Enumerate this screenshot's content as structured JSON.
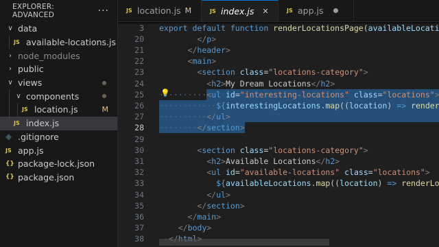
{
  "explorer": {
    "title": "EXPLORER: ADVANCED",
    "more": "···",
    "items": [
      {
        "label": "data",
        "chevron": "∨",
        "indent": 0,
        "type": "folder"
      },
      {
        "label": "available-locations.js",
        "indent": 1,
        "type": "js",
        "icon": "JS"
      },
      {
        "label": "node_modules",
        "chevron": "›",
        "indent": 0,
        "type": "folder",
        "dim": true
      },
      {
        "label": "public",
        "chevron": "›",
        "indent": 0,
        "type": "folder"
      },
      {
        "label": "views",
        "chevron": "∨",
        "indent": 0,
        "type": "folder",
        "dot": true
      },
      {
        "label": "components",
        "chevron": "∨",
        "indent": 1,
        "type": "folder",
        "dot": true
      },
      {
        "label": "location.js",
        "indent": 2,
        "type": "js",
        "icon": "JS",
        "badge": "M"
      },
      {
        "label": "index.js",
        "indent": 1,
        "type": "js",
        "icon": "JS",
        "selected": true
      },
      {
        "label": ".gitignore",
        "indent": 0,
        "type": "git",
        "icon": "◆"
      },
      {
        "label": "app.js",
        "indent": 0,
        "type": "js",
        "icon": "JS"
      },
      {
        "label": "package-lock.json",
        "indent": 0,
        "type": "json",
        "icon": "{}"
      },
      {
        "label": "package.json",
        "indent": 0,
        "type": "json",
        "icon": "{}"
      }
    ]
  },
  "tabs": [
    {
      "icon": "JS",
      "label": "location.js",
      "badge": "M"
    },
    {
      "icon": "JS",
      "label": "index.js",
      "active": true,
      "close": "✕"
    },
    {
      "icon": "JS",
      "label": "app.js",
      "unsaved": true
    }
  ],
  "editor": {
    "lightbulb": "💡",
    "lines": [
      {
        "n": "3",
        "tokens": [
          [
            "kw",
            "export default function "
          ],
          [
            "fn",
            "renderLocationsPage"
          ],
          [
            "def",
            "("
          ],
          [
            "var",
            "availableLocation"
          ]
        ]
      },
      {
        "n": "20",
        "tokens": [
          [
            "ind",
            "        "
          ],
          [
            "pun",
            "</"
          ],
          [
            "tag",
            "p"
          ],
          [
            "pun",
            ">"
          ]
        ]
      },
      {
        "n": "21",
        "tokens": [
          [
            "ind",
            "      "
          ],
          [
            "pun",
            "</"
          ],
          [
            "tag",
            "header"
          ],
          [
            "pun",
            ">"
          ]
        ]
      },
      {
        "n": "22",
        "tokens": [
          [
            "ind",
            "      "
          ],
          [
            "pun",
            "<"
          ],
          [
            "tag",
            "main"
          ],
          [
            "pun",
            ">"
          ]
        ]
      },
      {
        "n": "23",
        "tokens": [
          [
            "ind",
            "        "
          ],
          [
            "pun",
            "<"
          ],
          [
            "tag",
            "section"
          ],
          [
            "def",
            " "
          ],
          [
            "attr",
            "class"
          ],
          [
            "def",
            "="
          ],
          [
            "str",
            "\"locations-category\""
          ],
          [
            "pun",
            ">"
          ]
        ]
      },
      {
        "n": "24",
        "tokens": [
          [
            "ind",
            "          "
          ],
          [
            "pun",
            "<"
          ],
          [
            "tag",
            "h2"
          ],
          [
            "pun",
            ">"
          ],
          [
            "txt",
            "My Dream Locations"
          ],
          [
            "pun",
            "</"
          ],
          [
            "tag",
            "h2"
          ],
          [
            "pun",
            ">"
          ]
        ]
      },
      {
        "n": "25",
        "tokens": [
          [
            "ind",
            "          "
          ],
          [
            "pun",
            "<"
          ],
          [
            "tag",
            "ul"
          ],
          [
            "def",
            " "
          ],
          [
            "attr",
            "id"
          ],
          [
            "def",
            "="
          ],
          [
            "str",
            "\"interesting-locations\""
          ],
          [
            "def",
            " "
          ],
          [
            "attr",
            "class"
          ],
          [
            "def",
            "="
          ],
          [
            "str",
            "\"locations\""
          ],
          [
            "pun",
            ">"
          ]
        ]
      },
      {
        "n": "26",
        "tokens": [
          [
            "ind",
            "            "
          ],
          [
            "tpl",
            "${"
          ],
          [
            "var",
            "interestingLocations"
          ],
          [
            "def",
            "."
          ],
          [
            "fn",
            "map"
          ],
          [
            "def",
            "(("
          ],
          [
            "var",
            "location"
          ],
          [
            "def",
            ") "
          ],
          [
            "kw",
            "=>"
          ],
          [
            "def",
            " "
          ],
          [
            "fn",
            "renderLo"
          ]
        ]
      },
      {
        "n": "27",
        "tokens": [
          [
            "ind",
            "          "
          ],
          [
            "pun",
            "</"
          ],
          [
            "tag",
            "ul"
          ],
          [
            "pun",
            ">"
          ]
        ]
      },
      {
        "n": "28",
        "tokens": [
          [
            "ind",
            "        "
          ],
          [
            "pun",
            "</"
          ],
          [
            "tag",
            "section"
          ],
          [
            "pun",
            ">"
          ]
        ]
      },
      {
        "n": "29",
        "tokens": []
      },
      {
        "n": "30",
        "tokens": [
          [
            "ind",
            "        "
          ],
          [
            "pun",
            "<"
          ],
          [
            "tag",
            "section"
          ],
          [
            "def",
            " "
          ],
          [
            "attr",
            "class"
          ],
          [
            "def",
            "="
          ],
          [
            "str",
            "\"locations-category\""
          ],
          [
            "pun",
            ">"
          ]
        ]
      },
      {
        "n": "31",
        "tokens": [
          [
            "ind",
            "          "
          ],
          [
            "pun",
            "<"
          ],
          [
            "tag",
            "h2"
          ],
          [
            "pun",
            ">"
          ],
          [
            "txt",
            "Available Locations"
          ],
          [
            "pun",
            "</"
          ],
          [
            "tag",
            "h2"
          ],
          [
            "pun",
            ">"
          ]
        ]
      },
      {
        "n": "32",
        "tokens": [
          [
            "ind",
            "          "
          ],
          [
            "pun",
            "<"
          ],
          [
            "tag",
            "ul"
          ],
          [
            "def",
            " "
          ],
          [
            "attr",
            "id"
          ],
          [
            "def",
            "="
          ],
          [
            "str",
            "\"available-locations\""
          ],
          [
            "def",
            " "
          ],
          [
            "attr",
            "class"
          ],
          [
            "def",
            "="
          ],
          [
            "str",
            "\"locations\""
          ],
          [
            "pun",
            ">"
          ]
        ]
      },
      {
        "n": "33",
        "tokens": [
          [
            "ind",
            "            "
          ],
          [
            "tpl",
            "${"
          ],
          [
            "var",
            "availableLocations"
          ],
          [
            "def",
            "."
          ],
          [
            "fn",
            "map"
          ],
          [
            "def",
            "(("
          ],
          [
            "var",
            "location"
          ],
          [
            "def",
            ") "
          ],
          [
            "kw",
            "=>"
          ],
          [
            "def",
            " "
          ],
          [
            "fn",
            "renderLoca"
          ]
        ]
      },
      {
        "n": "34",
        "tokens": [
          [
            "ind",
            "          "
          ],
          [
            "pun",
            "</"
          ],
          [
            "tag",
            "ul"
          ],
          [
            "pun",
            ">"
          ]
        ]
      },
      {
        "n": "35",
        "tokens": [
          [
            "ind",
            "        "
          ],
          [
            "pun",
            "</"
          ],
          [
            "tag",
            "section"
          ],
          [
            "pun",
            ">"
          ]
        ]
      },
      {
        "n": "36",
        "tokens": [
          [
            "ind",
            "      "
          ],
          [
            "pun",
            "</"
          ],
          [
            "tag",
            "main"
          ],
          [
            "pun",
            ">"
          ]
        ]
      },
      {
        "n": "37",
        "tokens": [
          [
            "ind",
            "    "
          ],
          [
            "pun",
            "</"
          ],
          [
            "tag",
            "body"
          ],
          [
            "pun",
            ">"
          ]
        ]
      },
      {
        "n": "38",
        "tokens": [
          [
            "ind",
            "  "
          ],
          [
            "pun",
            "</"
          ],
          [
            "tag",
            "html"
          ],
          [
            "pun",
            ">"
          ]
        ]
      }
    ],
    "current_line": "28",
    "selected_lines": [
      "25",
      "26",
      "27",
      "28"
    ]
  }
}
